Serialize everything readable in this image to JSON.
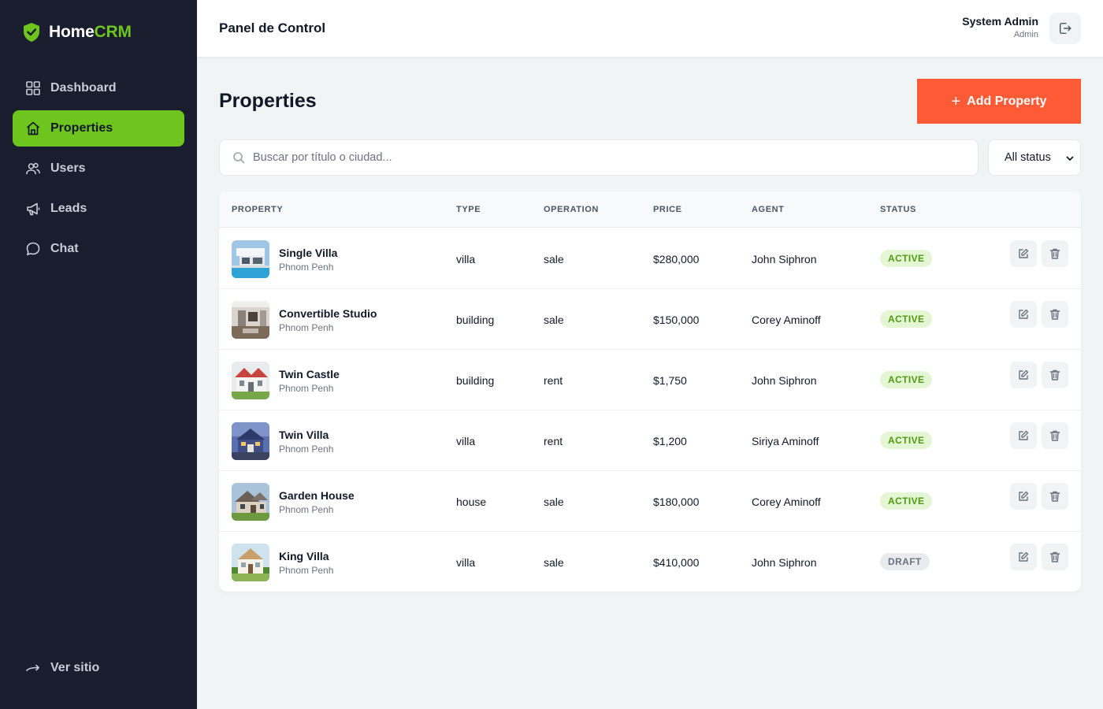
{
  "brand": {
    "part1": "Home",
    "part2": "CRM"
  },
  "sidebar": {
    "items": [
      {
        "label": "Dashboard",
        "icon": "grid-icon"
      },
      {
        "label": "Properties",
        "icon": "home-icon",
        "active": true
      },
      {
        "label": "Users",
        "icon": "users-icon"
      },
      {
        "label": "Leads",
        "icon": "megaphone-icon"
      },
      {
        "label": "Chat",
        "icon": "chat-icon"
      }
    ],
    "visit_site": "Ver sitio"
  },
  "topbar": {
    "title": "Panel de Control",
    "user_name": "System Admin",
    "user_role": "Admin"
  },
  "main": {
    "title": "Properties",
    "add_label": "Add Property",
    "search_placeholder": "Buscar por título o ciudad...",
    "status_filter": "All status"
  },
  "table": {
    "headers": {
      "property": "PROPERTY",
      "type": "TYPE",
      "operation": "OPERATION",
      "price": "PRICE",
      "agent": "AGENT",
      "status": "STATUS"
    },
    "rows": [
      {
        "title": "Single Villa",
        "city": "Phnom Penh",
        "type": "villa",
        "operation": "sale",
        "price": "$280,000",
        "agent": "John Siphron",
        "status": "ACTIVE"
      },
      {
        "title": "Convertible Studio",
        "city": "Phnom Penh",
        "type": "building",
        "operation": "sale",
        "price": "$150,000",
        "agent": "Corey Aminoff",
        "status": "ACTIVE"
      },
      {
        "title": "Twin Castle",
        "city": "Phnom Penh",
        "type": "building",
        "operation": "rent",
        "price": "$1,750",
        "agent": "John Siphron",
        "status": "ACTIVE"
      },
      {
        "title": "Twin Villa",
        "city": "Phnom Penh",
        "type": "villa",
        "operation": "rent",
        "price": "$1,200",
        "agent": "Siriya Aminoff",
        "status": "ACTIVE"
      },
      {
        "title": "Garden House",
        "city": "Phnom Penh",
        "type": "house",
        "operation": "sale",
        "price": "$180,000",
        "agent": "Corey Aminoff",
        "status": "ACTIVE"
      },
      {
        "title": "King Villa",
        "city": "Phnom Penh",
        "type": "villa",
        "operation": "sale",
        "price": "$410,000",
        "agent": "John Siphron",
        "status": "DRAFT"
      }
    ]
  },
  "colors": {
    "sidebar_bg": "#1a1d2e",
    "accent_green": "#6ec51e",
    "accent_orange": "#ff5a36",
    "page_bg": "#f1f4f5"
  }
}
